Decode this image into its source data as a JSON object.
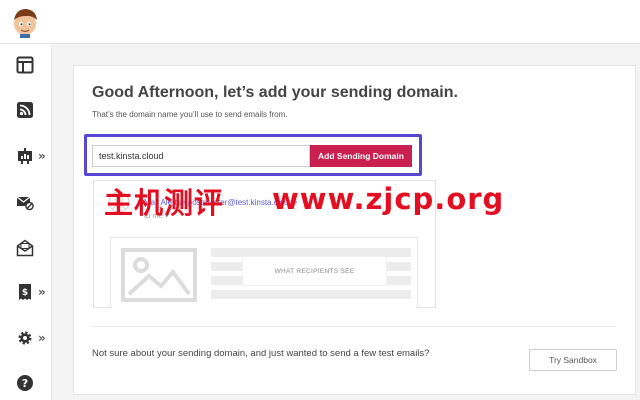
{
  "onboarding": {
    "title": "Good Afternoon, let’s add your sending domain.",
    "subtitle": "That’s the domain name you’ll use to send emails from.",
    "domain_value": "test.kinsta.cloud",
    "add_button_label": "Add Sending Domain"
  },
  "preview": {
    "sender": "Mail Alerts <postmaster@test.kinsta.cloud>",
    "to": "to me ▾",
    "placeholder_label": "WHAT RECIPIENTS SEE"
  },
  "sandbox": {
    "help_text": "Not sure about your sending domain, and just wanted to send a few test emails?",
    "button_label": "Try Sandbox"
  },
  "sidebar": {
    "items": [
      {
        "icon": "dashboard-icon",
        "has_submenu": false
      },
      {
        "icon": "rss-icon",
        "has_submenu": false
      },
      {
        "icon": "analytics-icon",
        "has_submenu": true,
        "chevron": "»"
      },
      {
        "icon": "mail-blocked-icon",
        "has_submenu": false
      },
      {
        "icon": "open-envelope-icon",
        "has_submenu": false
      },
      {
        "icon": "billing-icon",
        "has_submenu": true,
        "chevron": "»"
      },
      {
        "icon": "gear-icon",
        "has_submenu": true,
        "chevron": "»"
      },
      {
        "icon": "help-icon",
        "has_submenu": false
      }
    ]
  },
  "watermark": {
    "chinese": "主机测评",
    "url": "www.zjcp.org"
  },
  "colors": {
    "accent": "#c9204f",
    "highlight": "#5747d6",
    "watermark": "#e30e1f"
  }
}
